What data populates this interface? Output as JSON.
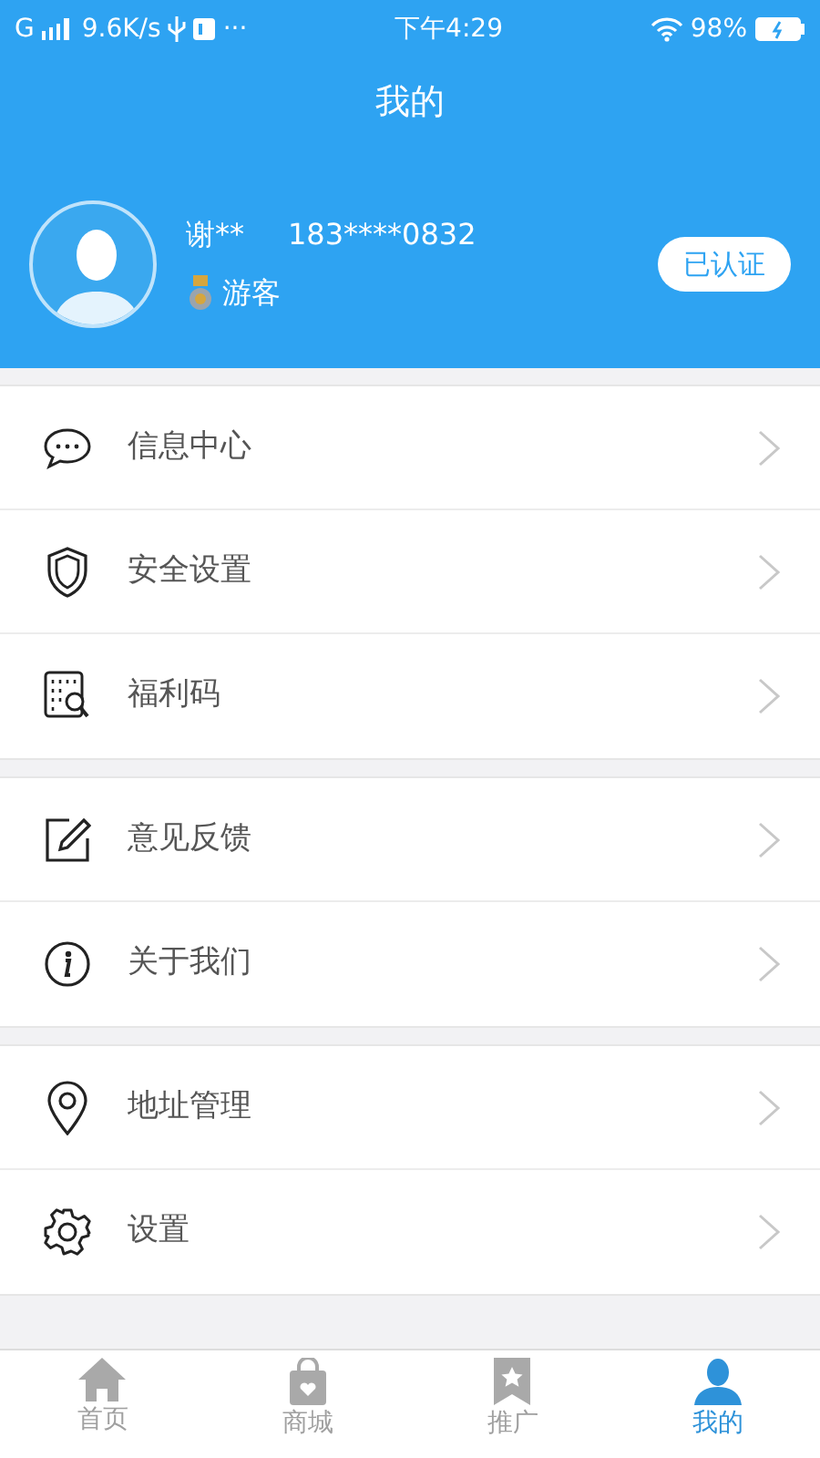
{
  "status_bar": {
    "carrier": "G",
    "speed": "9.6K/s",
    "more": "···",
    "time": "下午4:29",
    "battery": "98%"
  },
  "header": {
    "title": "我的"
  },
  "profile": {
    "name": "谢**",
    "phone": "183****0832",
    "level": "游客",
    "verified": "已认证"
  },
  "menu_groups": [
    [
      {
        "label": "信息中心"
      },
      {
        "label": "安全设置"
      },
      {
        "label": "福利码"
      }
    ],
    [
      {
        "label": "意见反馈"
      },
      {
        "label": "关于我们"
      }
    ],
    [
      {
        "label": "地址管理"
      },
      {
        "label": "设置"
      }
    ]
  ],
  "tabs": [
    {
      "label": "首页",
      "selected": false
    },
    {
      "label": "商城",
      "selected": false
    },
    {
      "label": "推广",
      "selected": false
    },
    {
      "label": "我的",
      "selected": true
    }
  ]
}
